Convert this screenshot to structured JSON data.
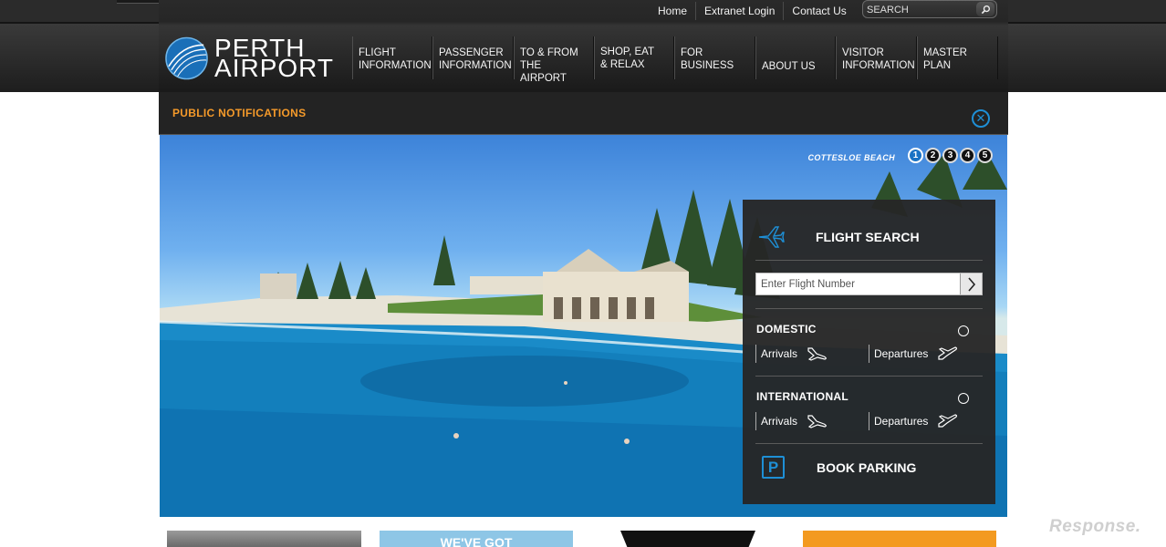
{
  "utility_links": [
    "Home",
    "Extranet Login",
    "Contact Us"
  ],
  "search": {
    "placeholder": "SEARCH"
  },
  "logo": {
    "line1": "PERTH",
    "line2": "AIRPORT"
  },
  "nav": [
    {
      "line1": "FLIGHT",
      "line2": "INFORMATION"
    },
    {
      "line1": "PASSENGER",
      "line2": "INFORMATION"
    },
    {
      "line1": "TO & FROM",
      "line2": "THE AIRPORT"
    },
    {
      "line1": "SHOP, EAT",
      "line2": "& RELAX"
    },
    {
      "line1": "FOR",
      "line2": "BUSINESS"
    },
    {
      "line1": "",
      "line2": "ABOUT US"
    },
    {
      "line1": "VISITOR",
      "line2": "INFORMATION"
    },
    {
      "line1": "MASTER",
      "line2": "PLAN"
    }
  ],
  "notifications": {
    "title": "PUBLIC NOTIFICATIONS",
    "close_icon": "close-circle-icon",
    "accent": "#f59a2a"
  },
  "hero": {
    "caption": "COTTESLOE BEACH",
    "pages": [
      "1",
      "2",
      "3",
      "4",
      "5"
    ],
    "active_page": "1"
  },
  "flight_panel": {
    "title": "FLIGHT SEARCH",
    "input_placeholder": "Enter Flight Number",
    "domestic": {
      "title": "DOMESTIC",
      "arrivals": "Arrivals",
      "departures": "Departures"
    },
    "international": {
      "title": "INTERNATIONAL",
      "arrivals": "Arrivals",
      "departures": "Departures"
    },
    "parking": {
      "title": "BOOK PARKING",
      "icon_letter": "P"
    },
    "accent": "#1e8fd6"
  },
  "thumb_text": "WE'VE GOT",
  "watermark": "Response."
}
